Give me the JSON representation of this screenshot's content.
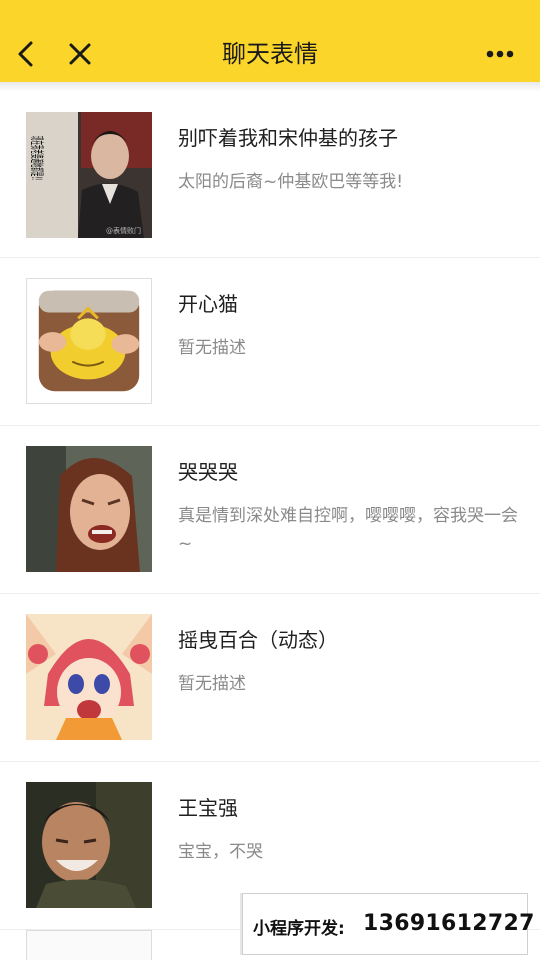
{
  "header": {
    "title": "聊天表情",
    "back_icon": "chevron-left-icon",
    "close_icon": "close-icon",
    "more_icon": "more-dots-icon",
    "background": "#fbd52a"
  },
  "items": [
    {
      "title": "别吓着我和宋仲基的孩子",
      "description": "太阳的后裔~仲基欧巴等等我!",
      "thumb_caption": "现在我老婆遍地都是!!",
      "thumb_watermark": "@表情败门"
    },
    {
      "title": "开心猫",
      "description": "暂无描述"
    },
    {
      "title": "哭哭哭",
      "description": "真是情到深处难自控啊，嘤嘤嘤，容我哭一会~"
    },
    {
      "title": "摇曳百合（动态）",
      "description": "暂无描述"
    },
    {
      "title": "王宝强",
      "description": "宝宝，不哭"
    }
  ],
  "ad": {
    "label": "小程序开发:",
    "phone": "13691612727"
  }
}
